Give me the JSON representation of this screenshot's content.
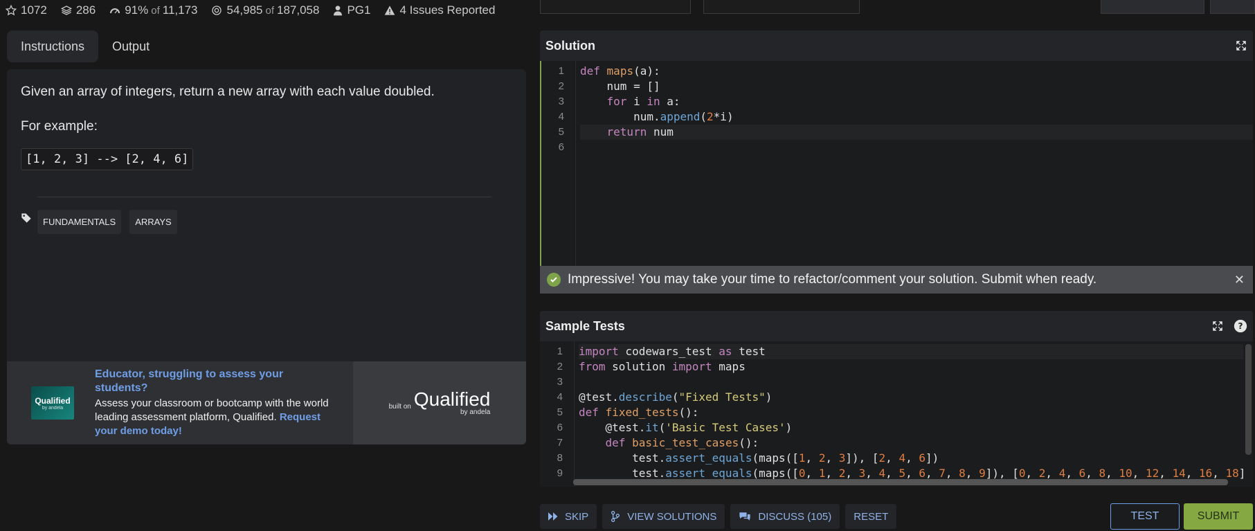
{
  "stats": {
    "stars": "1072",
    "collections": "286",
    "satisfaction": "91%",
    "satisfaction_of": "of",
    "satisfaction_total": "11,173",
    "completed": "54,985",
    "completed_of": "of",
    "completed_total": "187,058",
    "author": "PG1",
    "issues": "4 Issues Reported"
  },
  "tabs": [
    "Instructions",
    "Output"
  ],
  "instructions": {
    "text1": "Given an array of integers, return a new array with each value doubled.",
    "text2": "For example:",
    "example": "[1, 2, 3] --> [2, 4, 6]",
    "tags": [
      "FUNDAMENTALS",
      "ARRAYS"
    ]
  },
  "ad": {
    "logo_text": "Qualified",
    "logo_sub": "by andela",
    "title": "Educator, struggling to assess your students?",
    "body": "Assess your classroom or bootcamp with the world leading assessment platform, Qualified.",
    "link": "Request your demo today!",
    "built_on": "built on",
    "brand": "Qualified",
    "brand_sub": "by andela"
  },
  "solution": {
    "title": "Solution",
    "line_numbers": [
      "1",
      "2",
      "3",
      "4",
      "5",
      "6"
    ]
  },
  "success_message": "Impressive! You may take your time to refactor/comment your solution. Submit when ready.",
  "sample_tests": {
    "title": "Sample Tests",
    "line_numbers": [
      "1",
      "2",
      "3",
      "4",
      "5",
      "6",
      "7",
      "8",
      "9"
    ]
  },
  "actions": {
    "skip": "SKIP",
    "view_solutions": "VIEW SOLUTIONS",
    "discuss": "DISCUSS (105)",
    "reset": "RESET",
    "test": "TEST",
    "submit": "SUBMIT"
  },
  "colors": {
    "accent_blue": "#6f9ee6",
    "success_green": "#7fa34a",
    "submit_green": "#85a842"
  }
}
